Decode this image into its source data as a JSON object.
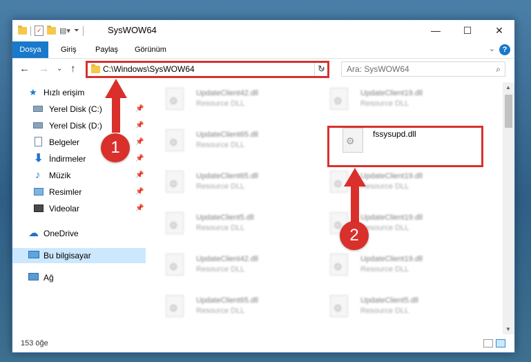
{
  "window": {
    "title": "SysWOW64",
    "controls": {
      "minimize": "—",
      "maximize": "☐",
      "close": "✕"
    }
  },
  "ribbon": {
    "tabs": [
      "Dosya",
      "Giriş",
      "Paylaş",
      "Görünüm"
    ],
    "help": "?",
    "collapse": "⌄"
  },
  "nav": {
    "back": "←",
    "forward": "→",
    "recent": "⌄",
    "up": "↑",
    "address": "C:\\Windows\\SysWOW64",
    "refresh": "↻",
    "search_placeholder": "Ara: SysWOW64",
    "search_icon": "⌕"
  },
  "sidebar": {
    "quick_access": "Hızlı erişim",
    "items": [
      {
        "label": "Yerel Disk (C:)",
        "icon": "drive-icon",
        "pinned": true
      },
      {
        "label": "Yerel Disk (D:)",
        "icon": "drive-icon",
        "pinned": true
      },
      {
        "label": "Belgeler",
        "icon": "documents-icon",
        "pinned": true
      },
      {
        "label": "İndirmeler",
        "icon": "downloads-icon",
        "pinned": true
      },
      {
        "label": "Müzik",
        "icon": "music-icon",
        "pinned": true
      },
      {
        "label": "Resimler",
        "icon": "pictures-icon",
        "pinned": true
      },
      {
        "label": "Videolar",
        "icon": "videos-icon",
        "pinned": true
      }
    ],
    "onedrive": "OneDrive",
    "this_pc": "Bu bilgisayar",
    "network": "Ağ",
    "pin_glyph": "📌"
  },
  "files": {
    "left": [
      {
        "name": "UpdateClient42.dll",
        "type": "Resource DLL"
      },
      {
        "name": "UpdateClient65.dll",
        "type": "Resource DLL"
      },
      {
        "name": "UpdateClient65.dll",
        "type": "Resource DLL"
      },
      {
        "name": "UpdateClient5.dll",
        "type": "Resource DLL"
      },
      {
        "name": "UpdateClient42.dll",
        "type": "Resource DLL"
      },
      {
        "name": "UpdateClient65.dll",
        "type": "Resource DLL"
      }
    ],
    "right": [
      {
        "name": "UpdateClient19.dll",
        "type": "Resource DLL"
      },
      {
        "name": "fssysupd.dll",
        "type": "",
        "highlight": true
      },
      {
        "name": "UpdateClient19.dll",
        "type": "Resource DLL"
      },
      {
        "name": "UpdateClient19.dll",
        "type": "Resource DLL"
      },
      {
        "name": "UpdateClient19.dll",
        "type": "Resource DLL"
      },
      {
        "name": "UpdateClient5.dll",
        "type": "Resource DLL"
      }
    ]
  },
  "status": {
    "count": "153 öğe"
  },
  "markers": [
    "1",
    "2"
  ],
  "colors": {
    "accent": "#1979ca",
    "annotation": "#d9302c",
    "selected": "#cce8ff"
  }
}
